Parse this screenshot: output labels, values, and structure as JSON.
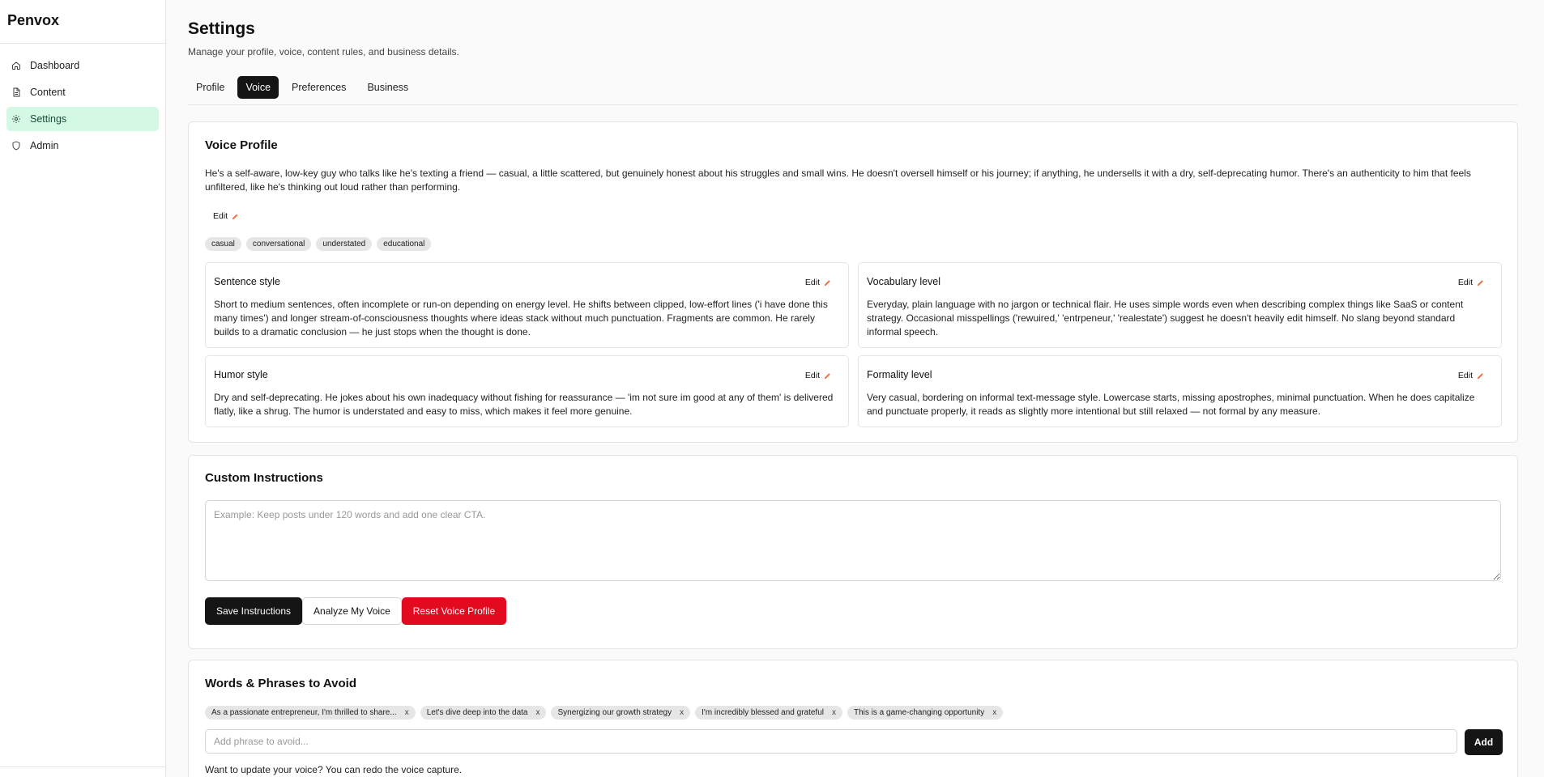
{
  "app": {
    "brand": "Penvox"
  },
  "sidebar": {
    "items": [
      {
        "label": "Dashboard",
        "icon": "home-icon"
      },
      {
        "label": "Content",
        "icon": "document-icon"
      },
      {
        "label": "Settings",
        "icon": "gear-icon",
        "active": true
      },
      {
        "label": "Admin",
        "icon": "shield-icon"
      }
    ]
  },
  "header": {
    "title": "Settings",
    "subtitle": "Manage your profile, voice, content rules, and business details."
  },
  "tabs": [
    {
      "label": "Profile"
    },
    {
      "label": "Voice",
      "active": true
    },
    {
      "label": "Preferences"
    },
    {
      "label": "Business"
    }
  ],
  "voice_profile": {
    "title": "Voice Profile",
    "description": "He's a self-aware, low-key guy who talks like he's texting a friend — casual, a little scattered, but genuinely honest about his struggles and small wins. He doesn't oversell himself or his journey; if anything, he undersells it with a dry, self-deprecating humor. There's an authenticity to him that feels unfiltered, like he's thinking out loud rather than performing.",
    "edit_label": "Edit",
    "tags": [
      "casual",
      "conversational",
      "understated",
      "educational"
    ],
    "traits": [
      {
        "name": "Sentence style",
        "edit_label": "Edit",
        "text": "Short to medium sentences, often incomplete or run-on depending on energy level. He shifts between clipped, low-effort lines ('i have done this many times') and longer stream-of-consciousness thoughts where ideas stack without much punctuation. Fragments are common. He rarely builds to a dramatic conclusion — he just stops when the thought is done."
      },
      {
        "name": "Vocabulary level",
        "edit_label": "Edit",
        "text": "Everyday, plain language with no jargon or technical flair. He uses simple words even when describing complex things like SaaS or content strategy. Occasional misspellings ('rewuired,' 'entrpeneur,' 'realestate') suggest he doesn't heavily edit himself. No slang beyond standard informal speech."
      },
      {
        "name": "Humor style",
        "edit_label": "Edit",
        "text": "Dry and self-deprecating. He jokes about his own inadequacy without fishing for reassurance — 'im not sure im good at any of them' is delivered flatly, like a shrug. The humor is understated and easy to miss, which makes it feel more genuine."
      },
      {
        "name": "Formality level",
        "edit_label": "Edit",
        "text": "Very casual, bordering on informal text-message style. Lowercase starts, missing apostrophes, minimal punctuation. When he does capitalize and punctuate properly, it reads as slightly more intentional but still relaxed — not formal by any measure."
      }
    ]
  },
  "custom_instructions": {
    "title": "Custom Instructions",
    "placeholder": "Example: Keep posts under 120 words and add one clear CTA.",
    "value": "",
    "save_label": "Save Instructions",
    "analyze_label": "Analyze My Voice",
    "reset_label": "Reset Voice Profile"
  },
  "avoid": {
    "title": "Words & Phrases to Avoid",
    "phrases": [
      "As a passionate entrepreneur, I'm thrilled to share...",
      "Let's dive deep into the data",
      "Synergizing our growth strategy",
      "I'm incredibly blessed and grateful",
      "This is a game-changing opportunity"
    ],
    "remove_label": "x",
    "input_placeholder": "Add phrase to avoid...",
    "add_label": "Add",
    "note": "Want to update your voice? You can redo the voice capture."
  },
  "colors": {
    "accent_active_bg": "#d3f9e5",
    "primary_dark": "#151515",
    "danger": "#e10a1e",
    "edit_pencil": "#f26b3a"
  }
}
